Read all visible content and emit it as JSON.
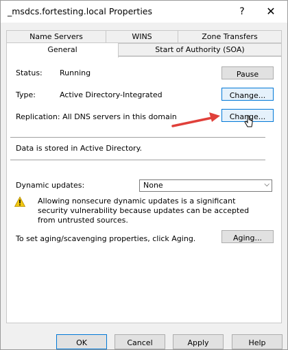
{
  "window": {
    "title": "_msdcs.fortesting.local Properties",
    "help": "?",
    "close": "✕"
  },
  "tabs_row1": [
    "Name Servers",
    "WINS",
    "Zone Transfers"
  ],
  "tabs_row2": [
    "General",
    "Start of Authority (SOA)"
  ],
  "general": {
    "status_label": "Status:",
    "status_value": "Running",
    "pause_button": "Pause",
    "type_label": "Type:",
    "type_value": "Active Directory-Integrated",
    "type_change_button": "Change...",
    "replication_text": "Replication: All DNS servers in this domain",
    "replication_change_button": "Change...",
    "storage_note": "Data is stored in Active Directory.",
    "dynamic_updates_label": "Dynamic updates:",
    "dynamic_updates_value": "None",
    "warning_text": "Allowing nonsecure dynamic updates is a significant security vulnerability because updates can be accepted from untrusted sources.",
    "aging_text": "To set aging/scavenging properties, click Aging.",
    "aging_button": "Aging..."
  },
  "footer": {
    "ok": "OK",
    "cancel": "Cancel",
    "apply": "Apply",
    "help": "Help"
  },
  "colors": {
    "accent": "#0078d7",
    "arrow": "#e0403a",
    "warning": "#f2c811"
  },
  "icons": {
    "warning": "warning-icon",
    "cursor": "mouse-cursor-icon",
    "annotation": "red-arrow"
  }
}
